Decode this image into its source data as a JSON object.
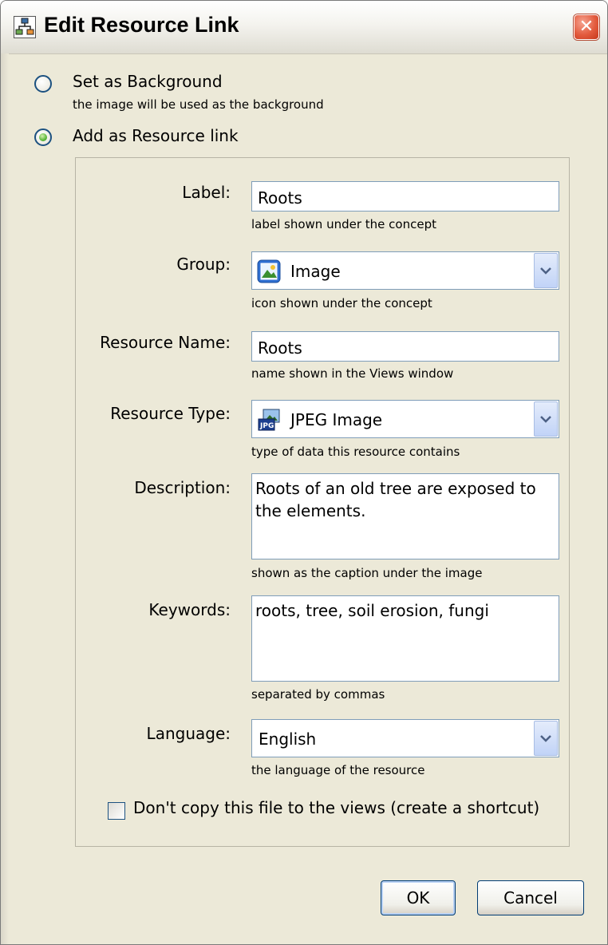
{
  "window": {
    "title": "Edit Resource Link",
    "close_label": "✕"
  },
  "mode": {
    "background_option": {
      "label": "Set as Background",
      "description": "the image will be used as the background",
      "selected": false
    },
    "resource_option": {
      "label": "Add as Resource link",
      "selected": true
    }
  },
  "form": {
    "label": {
      "caption": "Label:",
      "value": "Roots",
      "hint": "label shown under the concept"
    },
    "group": {
      "caption": "Group:",
      "value": "Image",
      "icon": "image-group-icon",
      "hint": "icon shown under the concept"
    },
    "resource_name": {
      "caption": "Resource Name:",
      "value": "Roots",
      "hint": "name shown in the Views window"
    },
    "resource_type": {
      "caption": "Resource Type:",
      "value": "JPEG Image",
      "icon": "jpeg-file-icon",
      "hint": "type of data this resource contains"
    },
    "description": {
      "caption": "Description:",
      "value": "Roots of an old tree are exposed to the elements.",
      "hint": "shown as the caption under the image"
    },
    "keywords": {
      "caption": "Keywords:",
      "value": "roots, tree, soil erosion, fungi",
      "hint": "separated by commas"
    },
    "language": {
      "caption": "Language:",
      "value": "English",
      "hint": "the language of the resource"
    },
    "no_copy": {
      "label": "Don't copy this file to the views (create a shortcut)",
      "checked": false
    }
  },
  "buttons": {
    "ok_label": "OK",
    "cancel_label": "Cancel"
  },
  "colors": {
    "dialog_bg": "#ece9d8",
    "field_border": "#7f9db9",
    "accent_blue": "#003c74",
    "radio_selected": "#5cb83c"
  }
}
